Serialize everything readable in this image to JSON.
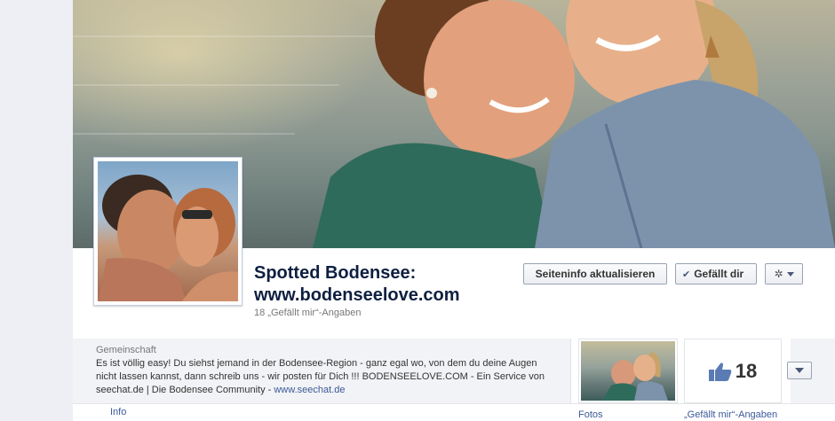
{
  "page": {
    "name_line1": "Spotted Bodensee:",
    "name_line2": "www.bodenseelove.com",
    "likes_text": "18 „Gefällt mir“-Angaben"
  },
  "actions": {
    "update_info_label": "Seiteninfo aktualisieren",
    "liked_label": "Gefällt dir",
    "check_icon": "check-icon",
    "gear_icon": "gear-icon"
  },
  "about": {
    "category": "Gemeinschaft",
    "description": "Es ist völlig easy! Du siehst jemand in der Bodensee-Region - ganz egal wo, von dem du deine Augen nicht lassen kannst, dann schreib uns - wir posten für Dich !!! BODENSEELOVE.COM - Ein Service von seechat.de | Die Bodensee Community - ",
    "link": "www.seechat.de"
  },
  "tabs": {
    "info": "Info"
  },
  "tiles": {
    "photos_label": "Fotos",
    "likes_count": "18",
    "likes_label": "„Gefällt mir“-Angaben"
  },
  "colors": {
    "link": "#3b5998",
    "name": "#0e1f40",
    "thumb_blue": "#5b7bb4"
  }
}
